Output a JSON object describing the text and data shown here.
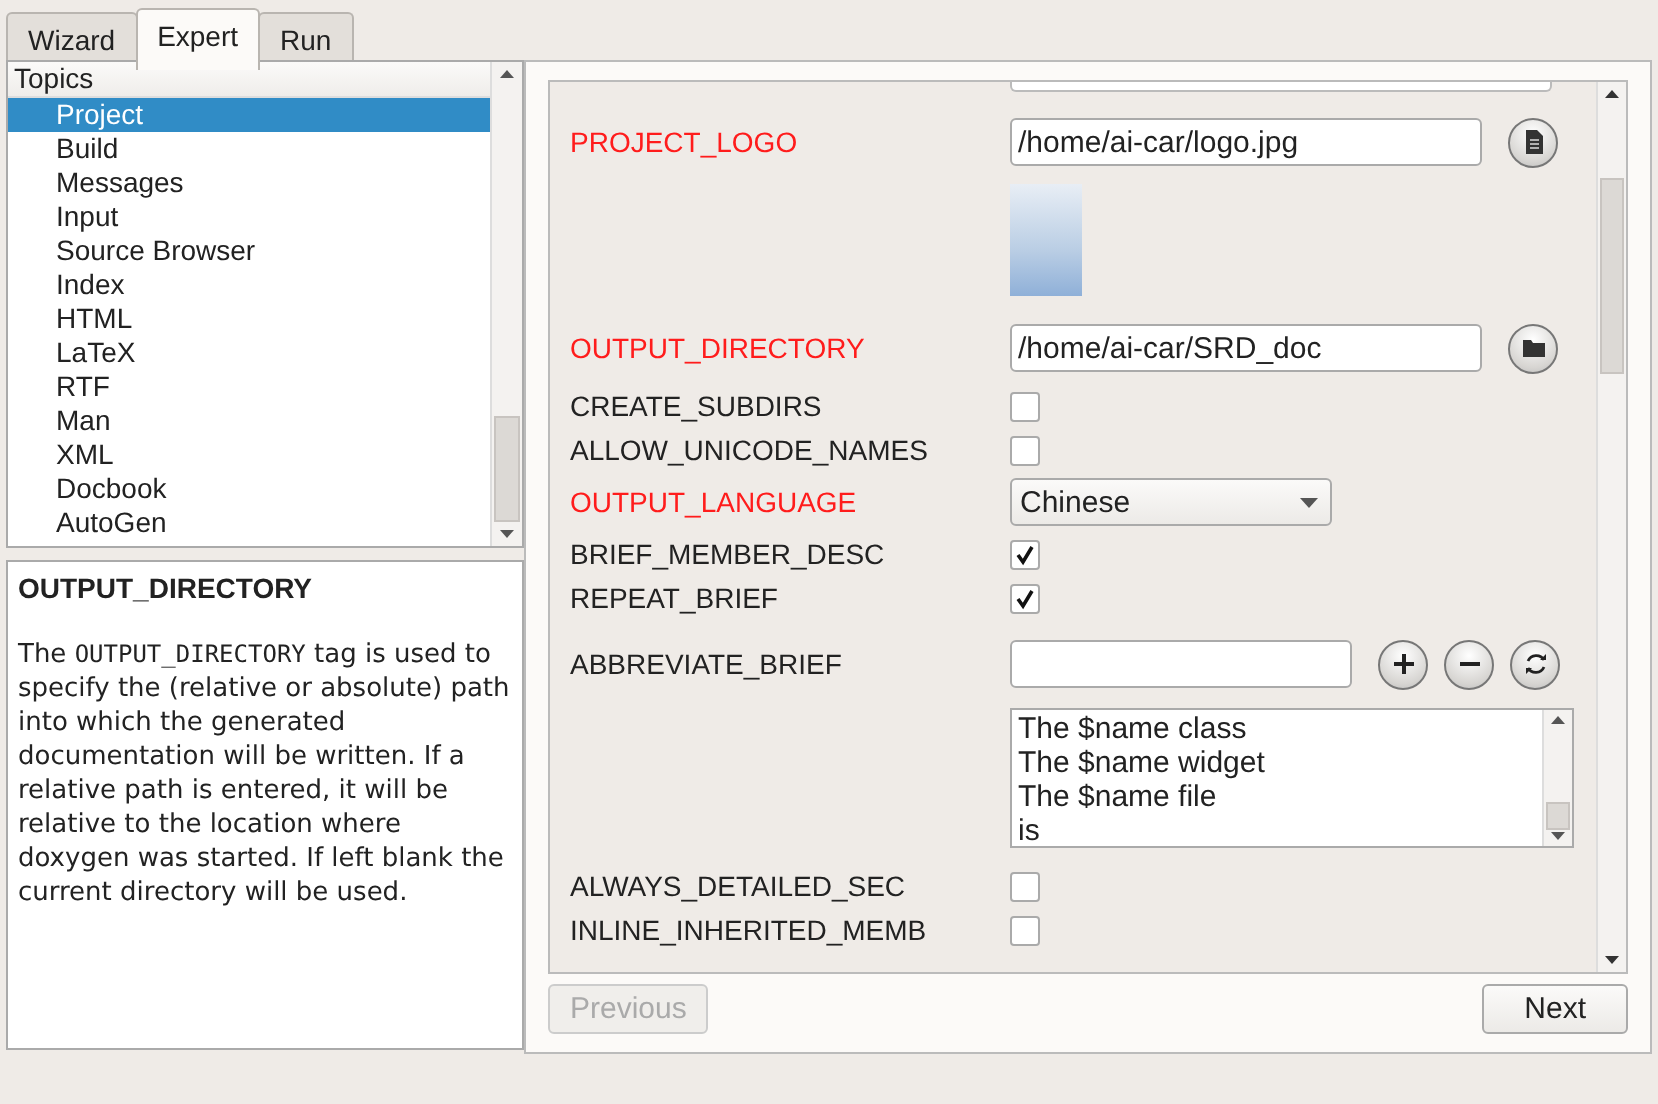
{
  "tabs": [
    {
      "label": "Wizard",
      "selected": false
    },
    {
      "label": "Expert",
      "selected": true
    },
    {
      "label": "Run",
      "selected": false
    }
  ],
  "topics": {
    "header": "Topics",
    "items": [
      {
        "label": "Project",
        "selected": true
      },
      {
        "label": "Build",
        "selected": false
      },
      {
        "label": "Messages",
        "selected": false
      },
      {
        "label": "Input",
        "selected": false
      },
      {
        "label": "Source Browser",
        "selected": false
      },
      {
        "label": "Index",
        "selected": false
      },
      {
        "label": "HTML",
        "selected": false
      },
      {
        "label": "LaTeX",
        "selected": false
      },
      {
        "label": "RTF",
        "selected": false
      },
      {
        "label": "Man",
        "selected": false
      },
      {
        "label": "XML",
        "selected": false
      },
      {
        "label": "Docbook",
        "selected": false
      },
      {
        "label": "AutoGen",
        "selected": false
      }
    ]
  },
  "description": {
    "title": "OUTPUT_DIRECTORY",
    "before": "The ",
    "code": "OUTPUT_DIRECTORY",
    "after": " tag is used to specify the (relative or absolute) path into which the generated documentation will be written. If a relative path is entered, it will be relative to the location where doxygen was started. If left blank the current directory will be used."
  },
  "settings": [
    {
      "kind": "file",
      "label": "PROJECT_LOGO",
      "modified": true,
      "value": "/home/ai-car/logo.jpg"
    },
    {
      "kind": "image"
    },
    {
      "kind": "dir",
      "label": "OUTPUT_DIRECTORY",
      "modified": true,
      "value": "/home/ai-car/SRD_doc"
    },
    {
      "kind": "bool",
      "label": "CREATE_SUBDIRS",
      "modified": false,
      "checked": false
    },
    {
      "kind": "bool",
      "label": "ALLOW_UNICODE_NAMES",
      "modified": false,
      "checked": false
    },
    {
      "kind": "enum",
      "label": "OUTPUT_LANGUAGE",
      "modified": true,
      "value": "Chinese"
    },
    {
      "kind": "bool",
      "label": "BRIEF_MEMBER_DESC",
      "modified": false,
      "checked": true
    },
    {
      "kind": "bool",
      "label": "REPEAT_BRIEF",
      "modified": false,
      "checked": true
    },
    {
      "kind": "list",
      "label": "ABBREVIATE_BRIEF",
      "modified": false,
      "items": [
        "The $name class",
        "The $name widget",
        "The $name file",
        "is"
      ]
    },
    {
      "kind": "bool",
      "label": "ALWAYS_DETAILED_SEC",
      "modified": false,
      "checked": false
    },
    {
      "kind": "bool",
      "label": "INLINE_INHERITED_MEMB",
      "modified": false,
      "checked": false
    }
  ],
  "buttons": {
    "previous": {
      "label": "Previous",
      "disabled": true
    },
    "next": {
      "label": "Next",
      "disabled": false
    }
  }
}
